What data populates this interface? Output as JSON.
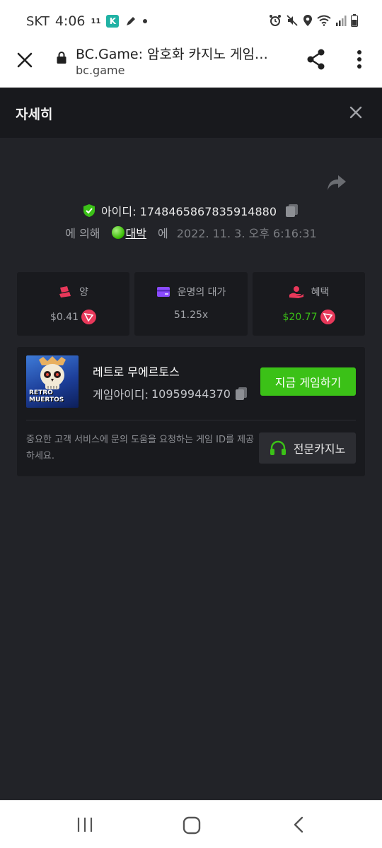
{
  "status_bar": {
    "carrier": "SKT",
    "time": "4:06",
    "network_badge": "11",
    "k_badge": "K",
    "icons": [
      "alarm-icon",
      "mute-icon",
      "location-icon",
      "wifi-icon",
      "signal-icon",
      "battery-icon"
    ]
  },
  "browser": {
    "title": "BC.Game: 암호화 카지노 게임…",
    "url": "bc.game",
    "icons": [
      "close-icon",
      "lock-icon",
      "share-icon",
      "more-vert-icon"
    ]
  },
  "modal": {
    "title": "자세히"
  },
  "bet": {
    "id_label": "아이디:",
    "id_value": "1748465867835914880",
    "by_prefix": "에 의해",
    "user_name": "대박",
    "at_label": "에",
    "datetime": "2022. 11. 3. 오후 6:16:31"
  },
  "stats": [
    {
      "label": "양",
      "value": "$0.41",
      "icon": "bet-amount-icon",
      "icon_color": "#e8385a"
    },
    {
      "label": "운명의 대가",
      "value": "51.25x",
      "icon": "payout-card-icon",
      "icon_color": "#8a4bff"
    },
    {
      "label": "혜택",
      "value": "$20.77",
      "icon": "profit-hand-icon",
      "icon_color": "#e8385a"
    }
  ],
  "game": {
    "thumb_line1": "RETRO",
    "thumb_line2": "MUERTOS",
    "name": "레트로 무에르토스",
    "id_label": "게임아이디:",
    "id_value": "10959944370",
    "play_button": "지금 게임하기",
    "notice": "중요한 고객 서비스에 문의 도움을 요청하는 게임 ID를 제공하세요.",
    "casino_button": "전문카지노"
  },
  "colors": {
    "accent_green": "#3bc117",
    "background": "#222328",
    "panel": "#191a1e",
    "header": "#18191d"
  }
}
